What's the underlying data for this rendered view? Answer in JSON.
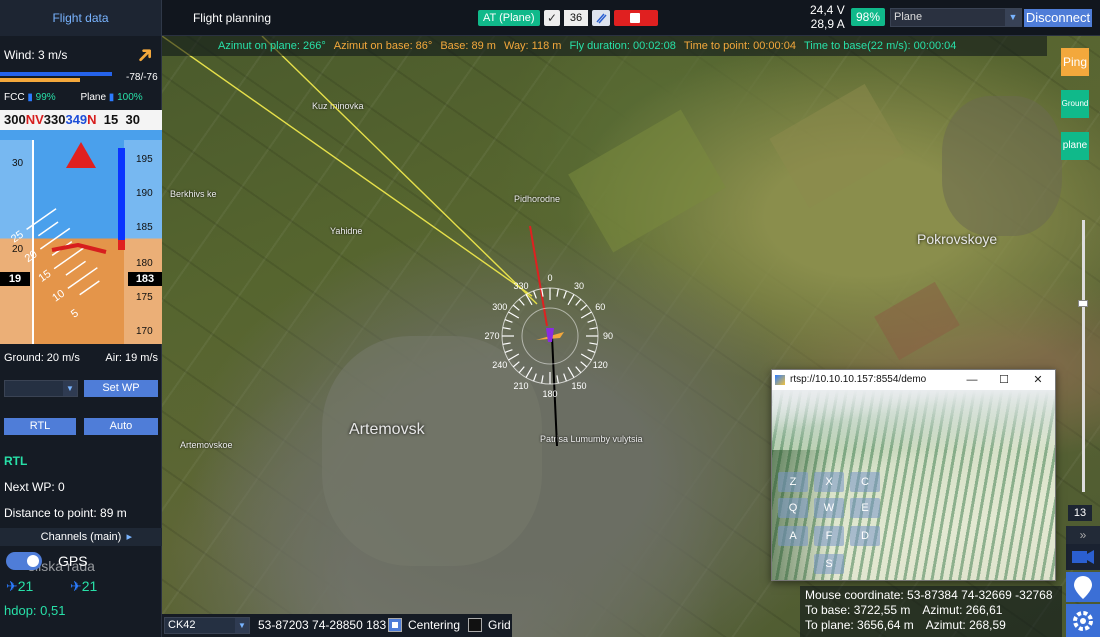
{
  "tabs": {
    "flight_data": "Flight data",
    "flight_planning": "Flight planning"
  },
  "topbar": {
    "mode": "AT (Plane)",
    "check": "✓",
    "channel_num": "36",
    "voltage": "24,4 V",
    "current": "28,9 A",
    "battery": "98%",
    "plane_select": "Plane",
    "disconnect": "Disconnect"
  },
  "info_strip": {
    "azimut_plane": "Azimut on plane: 266°",
    "azimut_base": "Azimut on base: 86°",
    "base": "Base: 89 m",
    "way": "Way: 118 m",
    "fly_duration": "Fly duration: 00:02:08",
    "time_to_point": "Time to point: 00:00:04",
    "time_to_base": "Time to base(22 m/s): 00:00:04"
  },
  "left": {
    "wind": "Wind: 3 m/s",
    "wind_value": "-78/-76",
    "fcc_label": "FCC",
    "fcc_pct": "99%",
    "plane_label": "Plane",
    "plane_pct": "100%",
    "compass": {
      "a": "300",
      "b": "NV",
      "c": "330",
      "d": "349",
      "e": "N",
      "f": "15",
      "g": "30"
    },
    "speed_ticks": [
      "30",
      "25",
      "20",
      "15",
      "10",
      "5"
    ],
    "alt_ticks": [
      "195",
      "190",
      "185",
      "180",
      "175",
      "170"
    ],
    "speed": "19",
    "altitude": "183",
    "ground": "Ground: 20 m/s",
    "air": "Air: 19 m/s",
    "set_wp": "Set WP",
    "rtl_btn": "RTL",
    "auto_btn": "Auto",
    "rtl_status": "RTL",
    "next_wp": "Next WP: 0",
    "distance": "Distance to point: 89 m",
    "channels": "Channels (main)",
    "gps": "GPS",
    "sats1": "21",
    "sats2": "21",
    "hdop": "hdop: 0,51",
    "ghost": "silska rada"
  },
  "map": {
    "towns": [
      "Artemovsk",
      "Pokrovskoye"
    ],
    "places": [
      "Kuz minovka",
      "Pidhorodne",
      "Yahidne",
      "Berkhivs ke",
      "Artemovskoe",
      "Patrisa Lumumby vulytsia"
    ],
    "compass_labels": [
      "0",
      "30",
      "60",
      "90",
      "120",
      "150",
      "180",
      "210",
      "240",
      "270",
      "300",
      "330"
    ]
  },
  "right": {
    "ping": "Ping",
    "ground": "Ground",
    "plane": "plane",
    "zoom": "13",
    "expand": "»"
  },
  "bottom": {
    "crs": "CK42",
    "coords": "53-87203 74-28850 183",
    "centering": "Centering",
    "grid": "Grid"
  },
  "mouse": {
    "coordinate": "Mouse coordinate: 53-87384 74-32669 -32768",
    "to_base": "To base: 3722,55 m",
    "azimut_base": "Azimut: 266,61",
    "to_plane": "To plane: 3656,64 m",
    "azimut_plane": "Azimut: 268,59"
  },
  "video": {
    "title": "rtsp://10.10.10.157:8554/demo",
    "keys": [
      "Z",
      "X",
      "C",
      "Q",
      "W",
      "E",
      "A",
      "F",
      "D",
      "S"
    ]
  },
  "colors": {
    "accent_blue": "#4f7dd8",
    "green": "#10b98a",
    "orange": "#f3a83c",
    "red": "#e02020"
  }
}
